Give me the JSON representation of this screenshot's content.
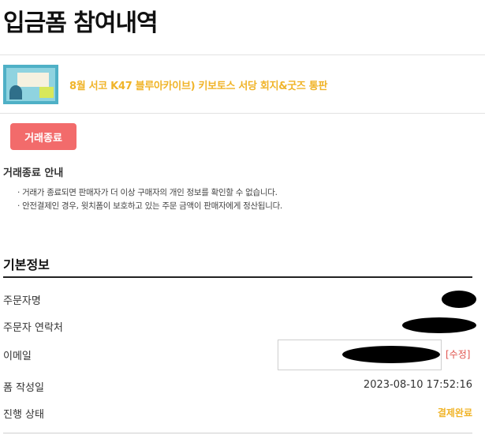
{
  "page": {
    "title": "입금폼 참여내역"
  },
  "product": {
    "title": "8월 서코 K47 블루아카이브) 키보토스 서당 회지&굿즈 통판",
    "thumbnail_icon": "product-thumbnail-image"
  },
  "status_button": {
    "label": "거래종료",
    "color": "#f26b6b"
  },
  "notice": {
    "title": "거래종료 안내",
    "lines": [
      "· 거래가 종료되면 판매자가 더 이상 구매자의 개인 정보를 확인할 수 없습니다.",
      "· 안전결제인 경우, 윗치폼이 보호하고 있는 주문 금액이 판매자에게 정산됩니다."
    ]
  },
  "basic_info": {
    "title": "기본정보",
    "rows": {
      "orderer_name": {
        "label": "주문자명",
        "value": ""
      },
      "orderer_contact": {
        "label": "주문자 연락처",
        "value": ""
      },
      "email": {
        "label": "이메일",
        "value": "",
        "edit_label": "[수정]"
      },
      "created_at": {
        "label": "폼 작성일",
        "value": "2023-08-10 17:52:16"
      },
      "progress": {
        "label": "진행 상태",
        "value": "결제완료",
        "color": "#f0b429"
      }
    }
  }
}
